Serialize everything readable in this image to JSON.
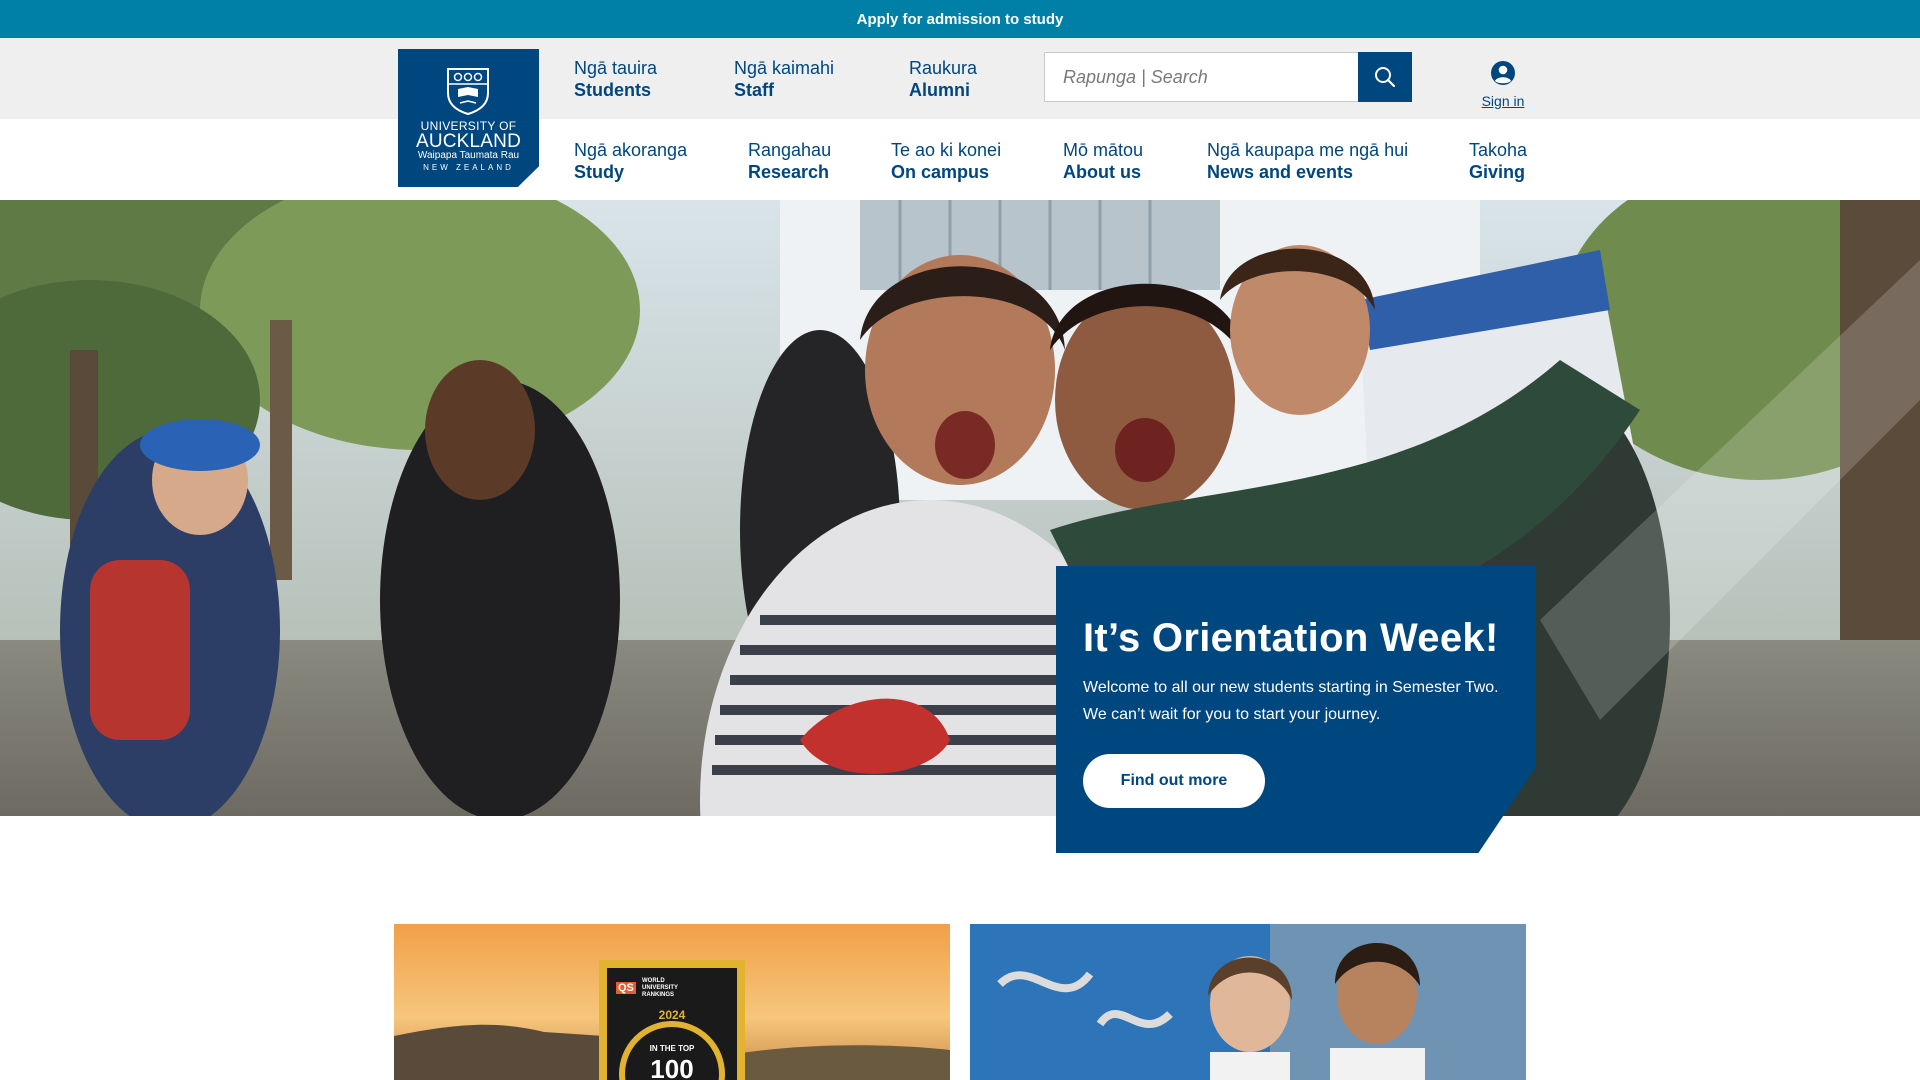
{
  "top_bar": {
    "link": "Apply for admission to study"
  },
  "logo": {
    "line1": "UNIVERSITY OF",
    "line2": "AUCKLAND",
    "line3": "Waipapa Taumata Rau",
    "line4": "NEW ZEALAND"
  },
  "audience_nav": [
    {
      "mi": "Ngā tauira",
      "en": "Students"
    },
    {
      "mi": "Ngā kaimahi",
      "en": "Staff"
    },
    {
      "mi": "Raukura",
      "en": "Alumni"
    }
  ],
  "search": {
    "placeholder": "Rapunga | Search",
    "icon": "search-icon"
  },
  "sign_in": {
    "label": "Sign in",
    "icon": "user-icon"
  },
  "main_nav": [
    {
      "mi": "Ngā akoranga",
      "en": "Study"
    },
    {
      "mi": "Rangahau",
      "en": "Research"
    },
    {
      "mi": "Te ao ki konei",
      "en": "On campus"
    },
    {
      "mi": "Mō mātou",
      "en": "About us"
    },
    {
      "mi": "Ngā kaupapa me ngā hui",
      "en": "News and events"
    },
    {
      "mi": "Takoha",
      "en": "Giving"
    }
  ],
  "hero": {
    "title": "It’s Orientation Week!",
    "text": "Welcome to all our new students starting in Semester Two. We can’t wait for you to start your journey.",
    "cta": "Find out more"
  },
  "cards": [
    {
      "badge_top": "WORLD UNIVERSITY RANKINGS",
      "badge_qs": "QS",
      "badge_year": "2024",
      "badge_in": "IN THE TOP",
      "badge_num": "100"
    },
    {}
  ],
  "colors": {
    "brand": "#00467f",
    "top_bar": "#0080a7",
    "header_grey": "#efefef"
  }
}
